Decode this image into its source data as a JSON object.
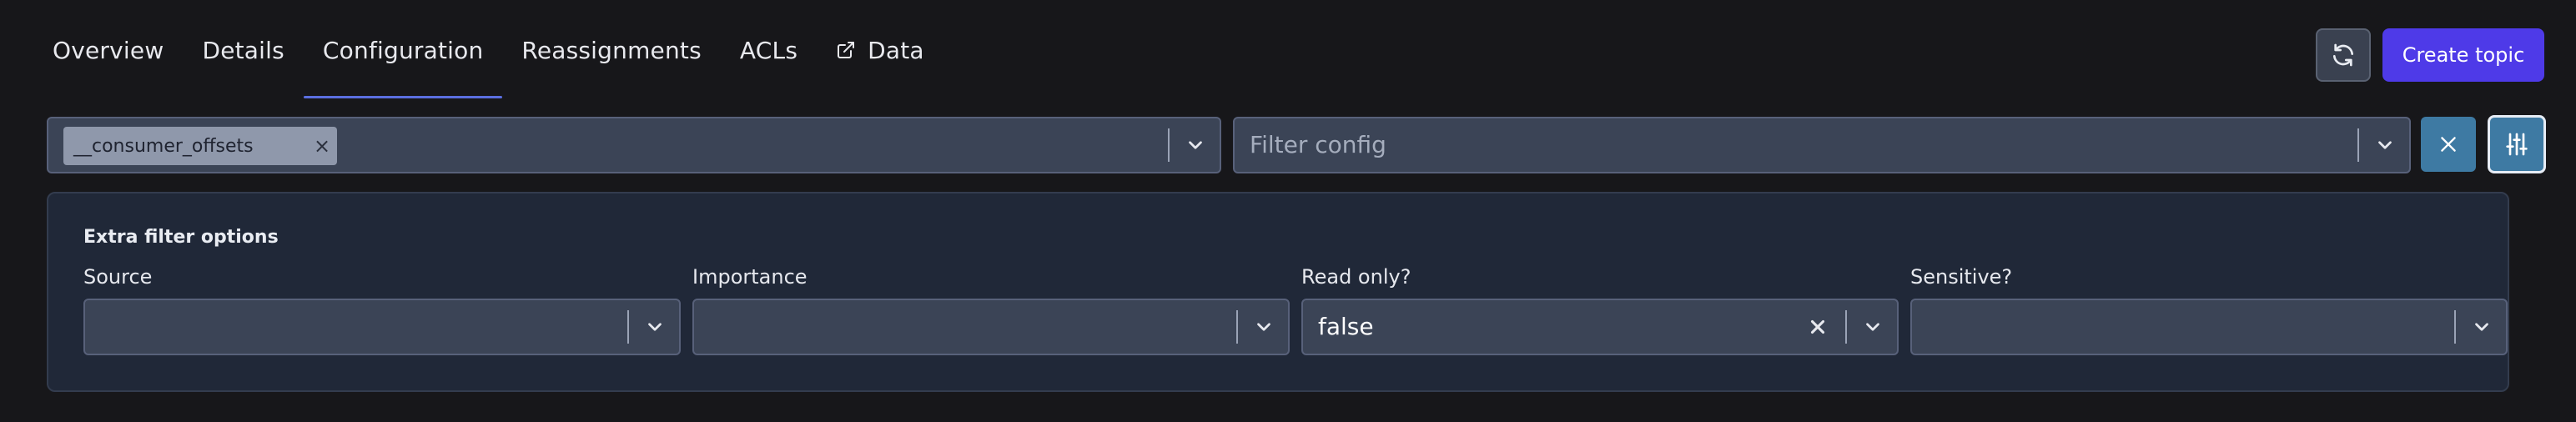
{
  "tabs": [
    {
      "label": "Overview",
      "active": false
    },
    {
      "label": "Details",
      "active": false
    },
    {
      "label": "Configuration",
      "active": true
    },
    {
      "label": "Reassignments",
      "active": false
    },
    {
      "label": "ACLs",
      "active": false
    },
    {
      "label": "Data",
      "active": false,
      "icon": "external-link-icon"
    }
  ],
  "header": {
    "refresh_icon": "refresh-icon",
    "create_label": "Create topic"
  },
  "filters": {
    "topic_chip": "__consumer_offsets",
    "config_placeholder": "Filter config"
  },
  "extra": {
    "title": "Extra filter options",
    "fields": [
      {
        "label": "Source",
        "value": ""
      },
      {
        "label": "Importance",
        "value": ""
      },
      {
        "label": "Read only?",
        "value": "false"
      },
      {
        "label": "Sensitive?",
        "value": ""
      }
    ]
  },
  "colors": {
    "background": "#17171a",
    "accent": "#4e3ae8",
    "active_tab_underline": "#5b6fe0",
    "teal_button": "#3e7aa3",
    "panel": "#202838",
    "input": "#3b4456"
  }
}
